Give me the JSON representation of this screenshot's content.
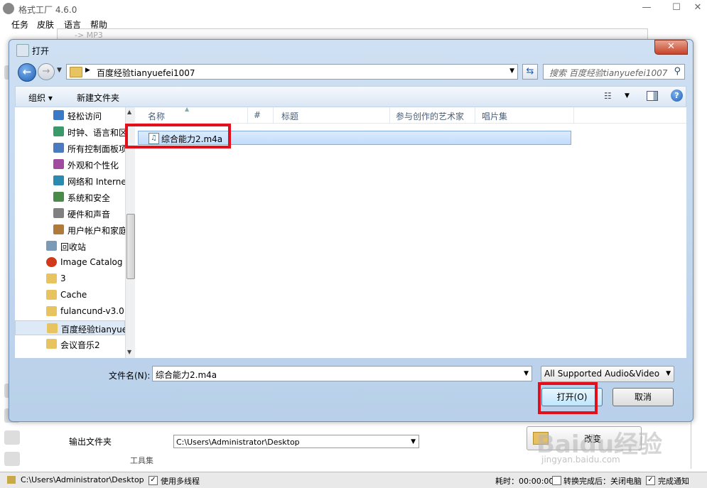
{
  "app": {
    "title": "格式工厂 4.6.0",
    "menu": [
      "任务",
      "皮肤",
      "语言",
      "帮助"
    ],
    "bg_panel_text": "-> MP3",
    "output_label": "输出文件夹",
    "output_path": "C:\\Users\\Administrator\\Desktop",
    "change_button": "改变",
    "toolbox_label": "工具集"
  },
  "statusbar": {
    "path": "C:\\Users\\Administrator\\Desktop",
    "multithread_label": "使用多线程",
    "multithread_checked": true,
    "elapsed": "耗时：00:00:00",
    "after_done": "转换完成后：关闭电脑",
    "notify_label": "完成通知",
    "notify_checked": true
  },
  "dialog": {
    "title": "打开",
    "close": "✕",
    "address_path": "百度经验tianyuefei1007",
    "search_placeholder": "搜索 百度经验tianyuefei1007",
    "organize": "组织 ▾",
    "new_folder": "新建文件夹",
    "nav_items": [
      {
        "label": "轻松访问",
        "icon": "accessibility-icon"
      },
      {
        "label": "时钟、语言和区",
        "icon": "globe-clock-icon"
      },
      {
        "label": "所有控制面板项",
        "icon": "control-panel-icon"
      },
      {
        "label": "外观和个性化",
        "icon": "appearance-icon"
      },
      {
        "label": "网络和 Interne",
        "icon": "network-icon"
      },
      {
        "label": "系统和安全",
        "icon": "system-security-icon"
      },
      {
        "label": "硬件和声音",
        "icon": "hardware-sound-icon"
      },
      {
        "label": "用户帐户和家庭",
        "icon": "user-accounts-icon"
      },
      {
        "label": "回收站",
        "icon": "recycle-bin-icon"
      },
      {
        "label": "Image Catalog",
        "icon": "image-catalog-icon"
      },
      {
        "label": "3",
        "icon": "folder-icon"
      },
      {
        "label": "Cache",
        "icon": "folder-icon"
      },
      {
        "label": "fulancund-v3.0",
        "icon": "folder-icon"
      },
      {
        "label": "百度经验tianyue",
        "icon": "folder-icon",
        "selected": true
      },
      {
        "label": "会议音乐2",
        "icon": "folder-icon"
      }
    ],
    "columns": [
      "名称",
      "#",
      "标题",
      "参与创作的艺术家",
      "唱片集"
    ],
    "files": [
      {
        "name": "综合能力2.m4a",
        "selected": true
      }
    ],
    "filename_label": "文件名(N):",
    "filename_value": "综合能力2.m4a",
    "filter": "All Supported Audio&Video",
    "open_button": "打开(O)",
    "cancel_button": "取消"
  },
  "watermark": {
    "text": "Baidu经验",
    "sub": "jingyan.baidu.com"
  },
  "colors": {
    "highlight": "#e3101c",
    "accent": "#1e5fb4",
    "dialog_frame": "#b9d0ea"
  }
}
